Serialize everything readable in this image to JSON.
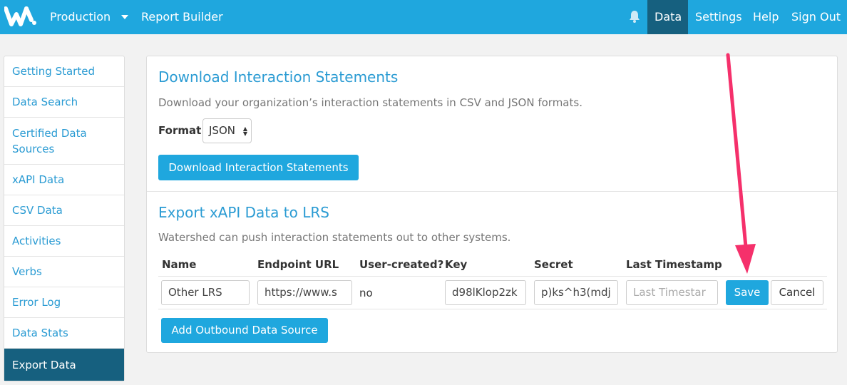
{
  "navbar": {
    "logo_icon": "watershed-logo-icon",
    "env_label": "Production",
    "report_builder": "Report Builder",
    "bell_icon": "bell-icon",
    "data": "Data",
    "settings": "Settings",
    "help": "Help",
    "sign_out": "Sign Out"
  },
  "sidebar": {
    "items": [
      {
        "label": "Getting Started"
      },
      {
        "label": "Data Search"
      },
      {
        "label": "Certified Data Sources"
      },
      {
        "label": "xAPI Data"
      },
      {
        "label": "CSV Data"
      },
      {
        "label": "Activities"
      },
      {
        "label": "Verbs"
      },
      {
        "label": "Error Log"
      },
      {
        "label": "Data Stats"
      },
      {
        "label": "Export Data"
      }
    ]
  },
  "download": {
    "title": "Download Interaction Statements",
    "description": "Download your organization’s interaction statements in CSV and JSON formats.",
    "format_label": "Format",
    "format_value": "JSON",
    "button": "Download Interaction Statements"
  },
  "export": {
    "title": "Export xAPI Data to LRS",
    "description": "Watershed can push interaction statements out to other systems.",
    "columns": [
      "Name",
      "Endpoint URL",
      "User-created?",
      "Key",
      "Secret",
      "Last Timestamp"
    ],
    "row": {
      "name": "Other LRS",
      "endpoint": "https://www.s",
      "user_created": "no",
      "key": "d98lKlop2zk",
      "secret": "p)ks^h3(mdj",
      "last_timestamp_placeholder": "Last Timestar"
    },
    "save": "Save",
    "cancel": "Cancel",
    "add_button": "Add Outbound Data Source"
  },
  "colors": {
    "brand": "#1fa7de",
    "active": "#16607f",
    "annotation": "#f5306b"
  }
}
